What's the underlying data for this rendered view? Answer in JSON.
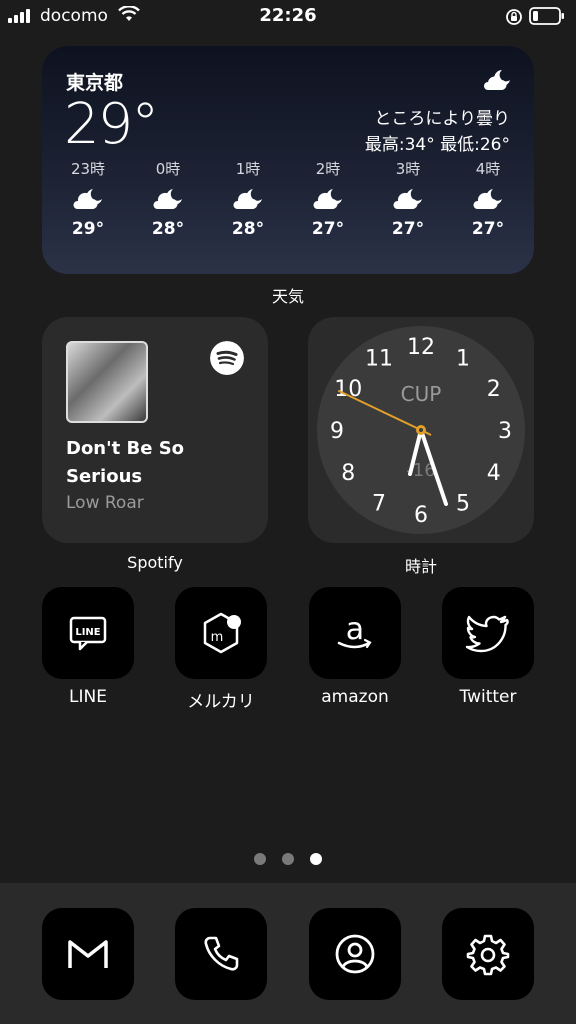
{
  "status_bar": {
    "carrier": "docomo",
    "time": "22:26"
  },
  "weather": {
    "city": "東京都",
    "temp": "29°",
    "condition": "ところにより曇り",
    "high_low": "最高:34° 最低:26°",
    "icon": "cloud-moon-icon",
    "hours": [
      {
        "label": "23時",
        "temp": "29°"
      },
      {
        "label": "0時",
        "temp": "28°"
      },
      {
        "label": "1時",
        "temp": "28°"
      },
      {
        "label": "2時",
        "temp": "27°"
      },
      {
        "label": "3時",
        "temp": "27°"
      },
      {
        "label": "4時",
        "temp": "27°"
      }
    ],
    "widget_label": "天気"
  },
  "spotify": {
    "song": "Don't Be So Serious",
    "artist": "Low Roar",
    "widget_label": "Spotify"
  },
  "clock": {
    "city": "CUP",
    "offset": "-16",
    "numbers": [
      "12",
      "1",
      "2",
      "3",
      "4",
      "5",
      "6",
      "7",
      "8",
      "9",
      "10",
      "11"
    ],
    "widget_label": "時計"
  },
  "apps": [
    {
      "label": "LINE",
      "icon": "line-icon"
    },
    {
      "label": "メルカリ",
      "icon": "mercari-icon"
    },
    {
      "label": "amazon",
      "icon": "amazon-icon"
    },
    {
      "label": "Twitter",
      "icon": "twitter-icon"
    }
  ],
  "page_dots": {
    "count": 3,
    "active": 3
  },
  "dock": [
    {
      "icon": "gmail-icon"
    },
    {
      "icon": "phone-icon"
    },
    {
      "icon": "contacts-icon"
    },
    {
      "icon": "settings-icon"
    }
  ],
  "colors": {
    "background": "#1c1c1d",
    "widget": "#2b2b2c",
    "clock_second_hand": "#e0a02a"
  }
}
